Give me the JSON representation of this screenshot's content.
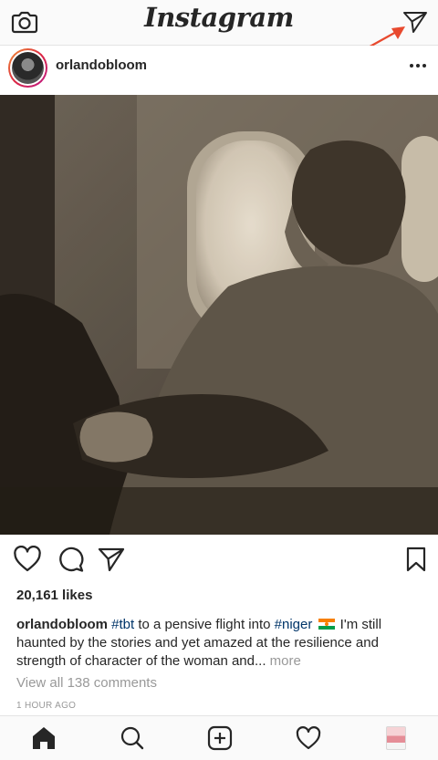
{
  "header": {
    "logo_text": "Instagram",
    "camera_icon": "camera-icon",
    "direct_icon": "paper-plane-icon"
  },
  "annotation": {
    "arrow_color": "#e8492e"
  },
  "post": {
    "username": "orlandobloom",
    "photo_description": "sepia-toned",
    "likes": "20,161 likes",
    "caption": {
      "username": "orlandobloom",
      "tag_tbt": "#tbt",
      "text_1": " to a pensive flight into ",
      "tag_niger": "#niger",
      "flag_icon": "niger-flag-icon",
      "text_2": " I'm still haunted by the stories and yet amazed at the resilience and strength of character of the woman and... ",
      "more_label": "more"
    },
    "view_comments": "View all 138 comments",
    "time_ago": "1 HOUR AGO"
  },
  "actions": {
    "like_icon": "heart-icon",
    "comment_icon": "comment-icon",
    "share_icon": "paper-plane-icon",
    "save_icon": "bookmark-icon"
  },
  "bottom_nav": {
    "items": [
      {
        "icon": "home-icon",
        "active": true
      },
      {
        "icon": "search-icon",
        "active": false
      },
      {
        "icon": "add-icon",
        "active": false
      },
      {
        "icon": "heart-icon",
        "active": false
      },
      {
        "icon": "profile-icon",
        "active": false
      }
    ]
  },
  "colors": {
    "text": "#262626",
    "muted": "#999999",
    "hashtag": "#003569",
    "bar_bg": "#fafafa",
    "arrow": "#e8492e"
  }
}
